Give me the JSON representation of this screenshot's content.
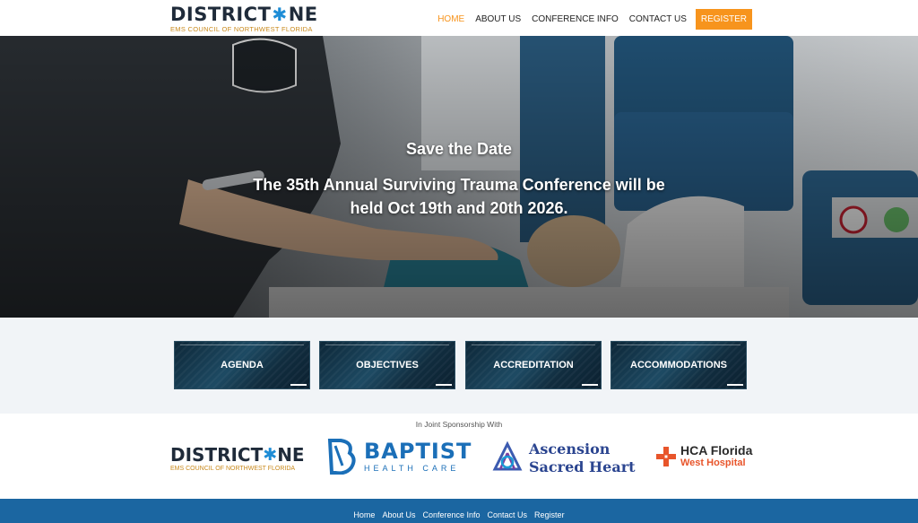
{
  "header": {
    "logo": {
      "word_left": "DISTRICT",
      "word_right": "NE",
      "star_glyph": "✱",
      "tagline": "EMS COUNCIL OF NORTHWEST FLORIDA"
    },
    "nav": [
      {
        "label": "HOME",
        "active": true
      },
      {
        "label": "ABOUT US",
        "active": false
      },
      {
        "label": "CONFERENCE INFO",
        "active": false
      },
      {
        "label": "CONTACT US",
        "active": false
      }
    ],
    "register_label": "REGISTER"
  },
  "hero": {
    "line1": "Save the Date",
    "line2": "The 35th Annual Surviving Trauma Conference will be held Oct 19th and 20th 2026."
  },
  "tiles": [
    "AGENDA",
    "OBJECTIVES",
    "ACCREDITATION",
    "ACCOMMODATIONS"
  ],
  "sponsors": {
    "label": "In Joint Sponsorship With",
    "district_one": {
      "word_left": "DISTRICT",
      "word_right": "NE",
      "star_glyph": "✱",
      "tagline": "EMS COUNCIL OF NORTHWEST FLORIDA"
    },
    "baptist": {
      "name": "BAPTIST",
      "sub": "HEALTH CARE"
    },
    "ascension": {
      "line1": "Ascension",
      "line2": "Sacred Heart"
    },
    "hca": {
      "line1": "HCA Florida",
      "line2": "West Hospital"
    }
  },
  "footer": {
    "links": [
      "Home",
      "About Us",
      "Conference Info",
      "Contact Us",
      "Register"
    ]
  },
  "colors": {
    "accent": "#f7941d",
    "footer": "#1b66a1",
    "navy": "#1f2b3a",
    "star_blue": "#1e8dd6"
  }
}
